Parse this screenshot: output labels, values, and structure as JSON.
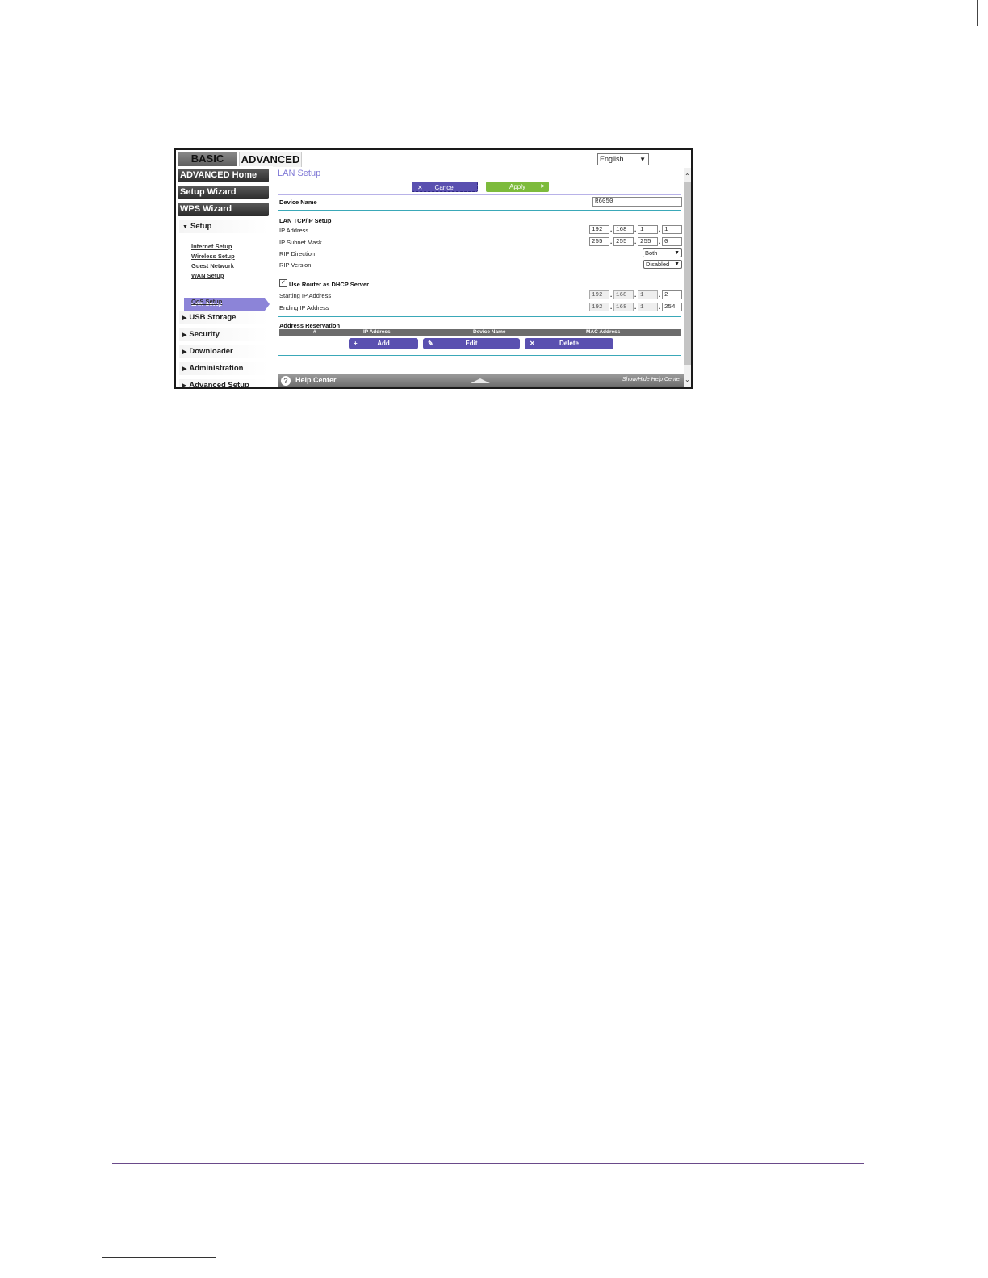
{
  "tabs": {
    "basic": "BASIC",
    "advanced": "ADVANCED"
  },
  "language": {
    "selected": "English"
  },
  "sidebar": {
    "advanced_home": "ADVANCED Home",
    "setup_wizard": "Setup Wizard",
    "wps_wizard": "WPS Wizard",
    "setup": "Setup",
    "setup_items": [
      "Internet Setup",
      "Wireless Setup",
      "Guest Network",
      "WAN Setup",
      "LAN Setup",
      "QoS Setup"
    ],
    "usb_storage": "USB Storage",
    "security": "Security",
    "downloader": "Downloader",
    "administration": "Administration",
    "advanced_setup": "Advanced Setup"
  },
  "page": {
    "title": "LAN Setup",
    "cancel": "Cancel",
    "apply": "Apply",
    "device_name_label": "Device Name",
    "device_name_value": "R6050",
    "lan_section": "LAN TCP/IP Setup",
    "ip_address_label": "IP Address",
    "ip_address": [
      "192",
      "168",
      "1",
      "1"
    ],
    "subnet_label": "IP Subnet Mask",
    "subnet": [
      "255",
      "255",
      "255",
      "0"
    ],
    "rip_direction_label": "RIP Direction",
    "rip_direction": "Both",
    "rip_version_label": "RIP Version",
    "rip_version": "Disabled",
    "dhcp_label": "Use Router as DHCP Server",
    "start_ip_label": "Starting IP Address",
    "start_ip": [
      "192",
      "168",
      "1",
      "2"
    ],
    "end_ip_label": "Ending IP Address",
    "end_ip": [
      "192",
      "168",
      "1",
      "254"
    ],
    "reservation_section": "Address Reservation",
    "table_headers": [
      "#",
      "IP Address",
      "Device Name",
      "MAC Address"
    ],
    "add": "Add",
    "edit": "Edit",
    "delete": "Delete"
  },
  "help": {
    "title": "Help Center",
    "toggle": "Show/Hide Help Center"
  },
  "colors": {
    "accent": "#7f78d6",
    "apply": "#7dbb3c",
    "button": "#5a50b0",
    "rule": "#3aa8b8"
  }
}
